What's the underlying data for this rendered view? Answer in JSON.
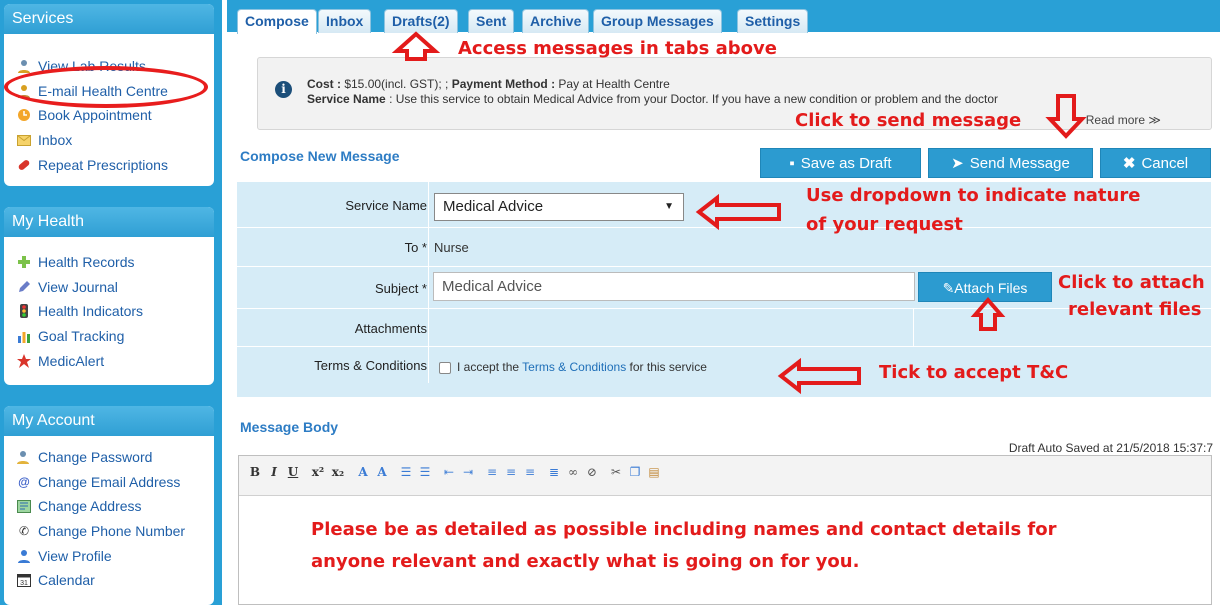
{
  "sidebar": {
    "services": {
      "title": "Services",
      "items": [
        {
          "label": "View Lab Results",
          "icon": "user-icon"
        },
        {
          "label": "E-mail Health Centre",
          "icon": "user-mail-icon"
        },
        {
          "label": "Book Appointment",
          "icon": "clock-icon"
        },
        {
          "label": "Inbox",
          "icon": "envelope-icon"
        },
        {
          "label": "Repeat Prescriptions",
          "icon": "pill-icon"
        }
      ]
    },
    "health": {
      "title": "My Health",
      "items": [
        {
          "label": "Health Records",
          "icon": "plus-icon"
        },
        {
          "label": "View Journal",
          "icon": "pencil-icon"
        },
        {
          "label": "Health Indicators",
          "icon": "traffic-light-icon"
        },
        {
          "label": "Goal Tracking",
          "icon": "bar-chart-icon"
        },
        {
          "label": "MedicAlert",
          "icon": "medic-alert-icon"
        }
      ]
    },
    "account": {
      "title": "My Account",
      "items": [
        {
          "label": "Change Password",
          "icon": "key-user-icon"
        },
        {
          "label": "Change Email Address",
          "icon": "at-sign-icon"
        },
        {
          "label": "Change Address",
          "icon": "map-icon"
        },
        {
          "label": "Change Phone Number",
          "icon": "phone-icon"
        },
        {
          "label": "View Profile",
          "icon": "profile-icon"
        },
        {
          "label": "Calendar",
          "icon": "calendar-icon"
        }
      ]
    }
  },
  "tabs": [
    "Compose",
    "Inbox",
    "Drafts(2)",
    "Sent",
    "Archive",
    "Group Messages",
    "Settings"
  ],
  "info": {
    "cost_label": "Cost :",
    "cost_value": " $15.00(incl. GST); ;",
    "payment_label": "Payment Method :",
    "payment_value": " Pay at Health Centre",
    "service_label": "Service Name",
    "service_value": " : Use this service to obtain Medical Advice from your Doctor. If you have a new condition or problem and the doctor",
    "read_more": "Read more ≫"
  },
  "compose": {
    "title": "Compose New Message",
    "save_draft": "Save as Draft",
    "send": "Send Message",
    "cancel": "Cancel"
  },
  "form": {
    "service_label": "Service Name",
    "service_value": "Medical Advice",
    "to_label": "To *",
    "to_value": "Nurse",
    "subject_label": "Subject *",
    "subject_value": "Medical Advice",
    "attach_label": "Attach Files",
    "attachments_label": "Attachments",
    "terms_label": "Terms & Conditions",
    "terms_pre": "I accept the ",
    "terms_link": "Terms & Conditions",
    "terms_post": " for this service"
  },
  "body": {
    "title": "Message Body",
    "autosave": "Draft Auto Saved at 21/5/2018 15:37:7"
  },
  "annotations": {
    "tabs": "Access messages in tabs above",
    "send": "Click to send message",
    "dropdown1": "Use dropdown to indicate nature",
    "dropdown2": "of your request",
    "attach1": "Click to attach",
    "attach2": "relevant files",
    "tick": "Tick to accept T&C",
    "body1": "Please be as detailed as possible including names and contact details for",
    "body2": "anyone relevant and exactly what is going on for you."
  },
  "colors": {
    "accent": "#29a0d6",
    "annotation": "#e31b1b",
    "button": "#2c9bd0"
  }
}
